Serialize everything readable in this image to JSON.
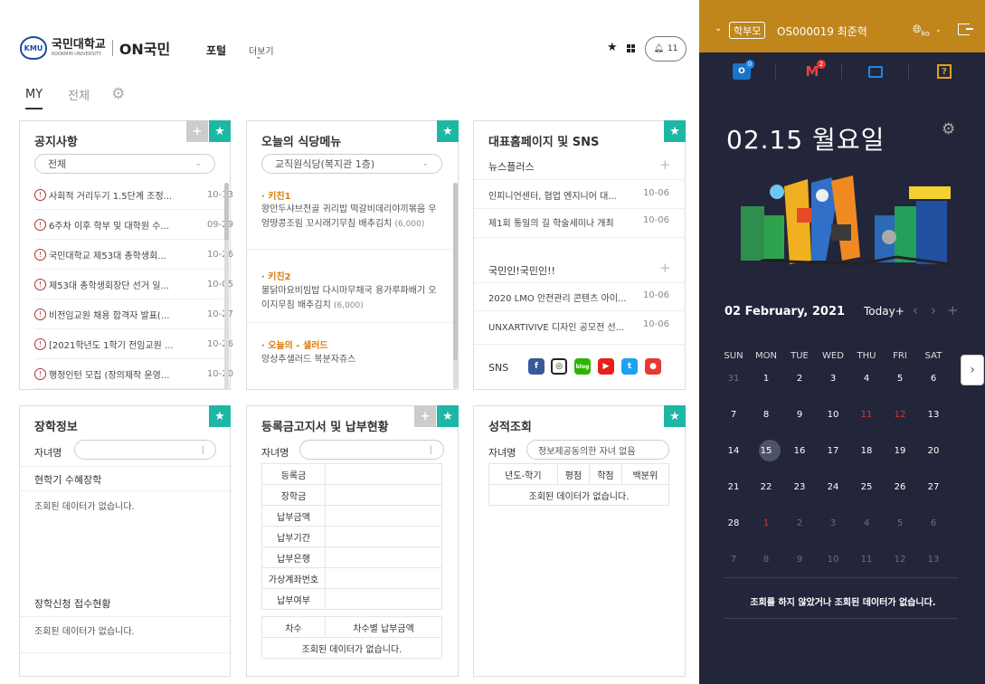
{
  "header": {
    "logo_emblem": "KMU",
    "logo_ko": "국민대학교",
    "logo_en": "KOOKMIN UNIVERSITY",
    "logo_on": "ON국민",
    "nav_portal": "포털",
    "nav_more": "더보기",
    "notification_count": "11"
  },
  "tabs": {
    "my": "MY",
    "all": "전체"
  },
  "notice": {
    "title": "공지사항",
    "filter": "전체",
    "items": [
      {
        "title": "사회적 거리두기 1.5단계 조정...",
        "date": "10-13"
      },
      {
        "title": "6주차 이후 학부 및 대학원 수...",
        "date": "09-29"
      },
      {
        "title": "국민대학교 제53대 총학생회...",
        "date": "10-26"
      },
      {
        "title": "제53대 총학생회장단 선거 일...",
        "date": "10-05"
      },
      {
        "title": "비전임교원 채용 합격자 발표(...",
        "date": "10-27"
      },
      {
        "title": "[2021학년도 1학기 전임교원 ...",
        "date": "10-26"
      },
      {
        "title": "행정인턴 모집 (장의제작 운영...",
        "date": "10-20"
      }
    ]
  },
  "cafeteria": {
    "title": "오늘의 식당메뉴",
    "filter": "교직원식당(복지관 1층)",
    "sections": [
      {
        "name": "· 키친1",
        "menu": "왕만두샤브전골 귀리밥 떡갈비데리야끼볶음 우엉땅콩조림 꼬시래기무침 배추김치",
        "price": "(6,000)"
      },
      {
        "name": "· 키친2",
        "menu": "불닭마요비빔밥 다시마무채국 용가루파배기 오이지무침 배추김치",
        "price": "(6,000)"
      },
      {
        "name": "· 오늘의 - 샐러드",
        "menu": "양상추샐러드 복분자쥬스",
        "price": ""
      }
    ]
  },
  "homepage": {
    "title": "대표홈페이지 및 SNS",
    "section1": {
      "title": "뉴스플러스",
      "items": [
        {
          "title": "인피니언센터, 협업 엔지니어 대...",
          "date": "10-06"
        },
        {
          "title": "제1회 통일의 길 학술세미나 개최",
          "date": "10-06"
        }
      ]
    },
    "section2": {
      "title": "국민인!국민인!!",
      "items": [
        {
          "title": "2020 LMO 안전관리 콘텐츠 아이...",
          "date": "10-06"
        },
        {
          "title": "UNXARTIVIVE 디자인 공모전 선...",
          "date": "10-06"
        }
      ]
    },
    "sns_label": "SNS"
  },
  "scholarship": {
    "title": "장학정보",
    "child_label": "자녀명",
    "current_title": "현학기 수혜장학",
    "current_empty": "조회된 데이터가 없습니다.",
    "apply_title": "장학신청 접수현황",
    "apply_empty": "조회된 데이터가 없습니다."
  },
  "tuition": {
    "title": "등록금고지서 및 납부현황",
    "child_label": "자녀명",
    "rows": [
      "등록금",
      "장학금",
      "납부금액",
      "납부기간",
      "납부은행",
      "가상계좌번호",
      "납부여부"
    ],
    "col_seq": "차수",
    "col_amount": "차수별 납부금액",
    "empty": "조회된 데이터가 없습니다."
  },
  "grades": {
    "title": "성적조회",
    "child_label": "자녀명",
    "child_value": "정보제공동의한 자녀 없음",
    "headers": [
      "년도-학기",
      "평점",
      "학점",
      "백분위"
    ],
    "empty": "조회된 데이터가 없습니다."
  },
  "sidebar": {
    "role": "학부모",
    "user": "OS000019 최준혁",
    "lang": "ko",
    "outlook_badge": "0",
    "gmail_badge": "2",
    "help_label": "?",
    "date_title": "02.15 월요일",
    "month_label": "02 February, 2021",
    "today_label": "Today+",
    "weekdays": [
      "SUN",
      "MON",
      "TUE",
      "WED",
      "THU",
      "FRI",
      "SAT"
    ],
    "weeks": [
      [
        {
          "d": "31",
          "t": "pv"
        },
        {
          "d": "1",
          "t": "cu"
        },
        {
          "d": "2",
          "t": "cu"
        },
        {
          "d": "3",
          "t": "cu"
        },
        {
          "d": "4",
          "t": "cu"
        },
        {
          "d": "5",
          "t": "cu"
        },
        {
          "d": "6",
          "t": "cu"
        }
      ],
      [
        {
          "d": "7",
          "t": "cu"
        },
        {
          "d": "8",
          "t": "cu"
        },
        {
          "d": "9",
          "t": "cu"
        },
        {
          "d": "10",
          "t": "cu"
        },
        {
          "d": "11",
          "t": "rd"
        },
        {
          "d": "12",
          "t": "rd"
        },
        {
          "d": "13",
          "t": "cu"
        }
      ],
      [
        {
          "d": "14",
          "t": "cu"
        },
        {
          "d": "15",
          "t": "sel"
        },
        {
          "d": "16",
          "t": "cu"
        },
        {
          "d": "17",
          "t": "cu"
        },
        {
          "d": "18",
          "t": "cu"
        },
        {
          "d": "19",
          "t": "cu"
        },
        {
          "d": "20",
          "t": "cu"
        }
      ],
      [
        {
          "d": "21",
          "t": "cu"
        },
        {
          "d": "22",
          "t": "cu"
        },
        {
          "d": "23",
          "t": "cu"
        },
        {
          "d": "24",
          "t": "cu"
        },
        {
          "d": "25",
          "t": "cu"
        },
        {
          "d": "26",
          "t": "cu"
        },
        {
          "d": "27",
          "t": "cu"
        }
      ],
      [
        {
          "d": "28",
          "t": "cu"
        },
        {
          "d": "1",
          "t": "rd"
        },
        {
          "d": "2",
          "t": "pv"
        },
        {
          "d": "3",
          "t": "pv"
        },
        {
          "d": "4",
          "t": "pv"
        },
        {
          "d": "5",
          "t": "pv"
        },
        {
          "d": "6",
          "t": "pv"
        }
      ],
      [
        {
          "d": "7",
          "t": "pv"
        },
        {
          "d": "8",
          "t": "pv"
        },
        {
          "d": "9",
          "t": "pv"
        },
        {
          "d": "10",
          "t": "pv"
        },
        {
          "d": "11",
          "t": "pv"
        },
        {
          "d": "12",
          "t": "pv"
        },
        {
          "d": "13",
          "t": "pv"
        }
      ]
    ],
    "empty_msg": "조회를 하지 않았거나 조회된 데이터가 없습니다."
  },
  "colors": {
    "accent": "#1eb7a6",
    "sidebar_bg": "#23263a",
    "sidebar_top": "#c0851b"
  }
}
